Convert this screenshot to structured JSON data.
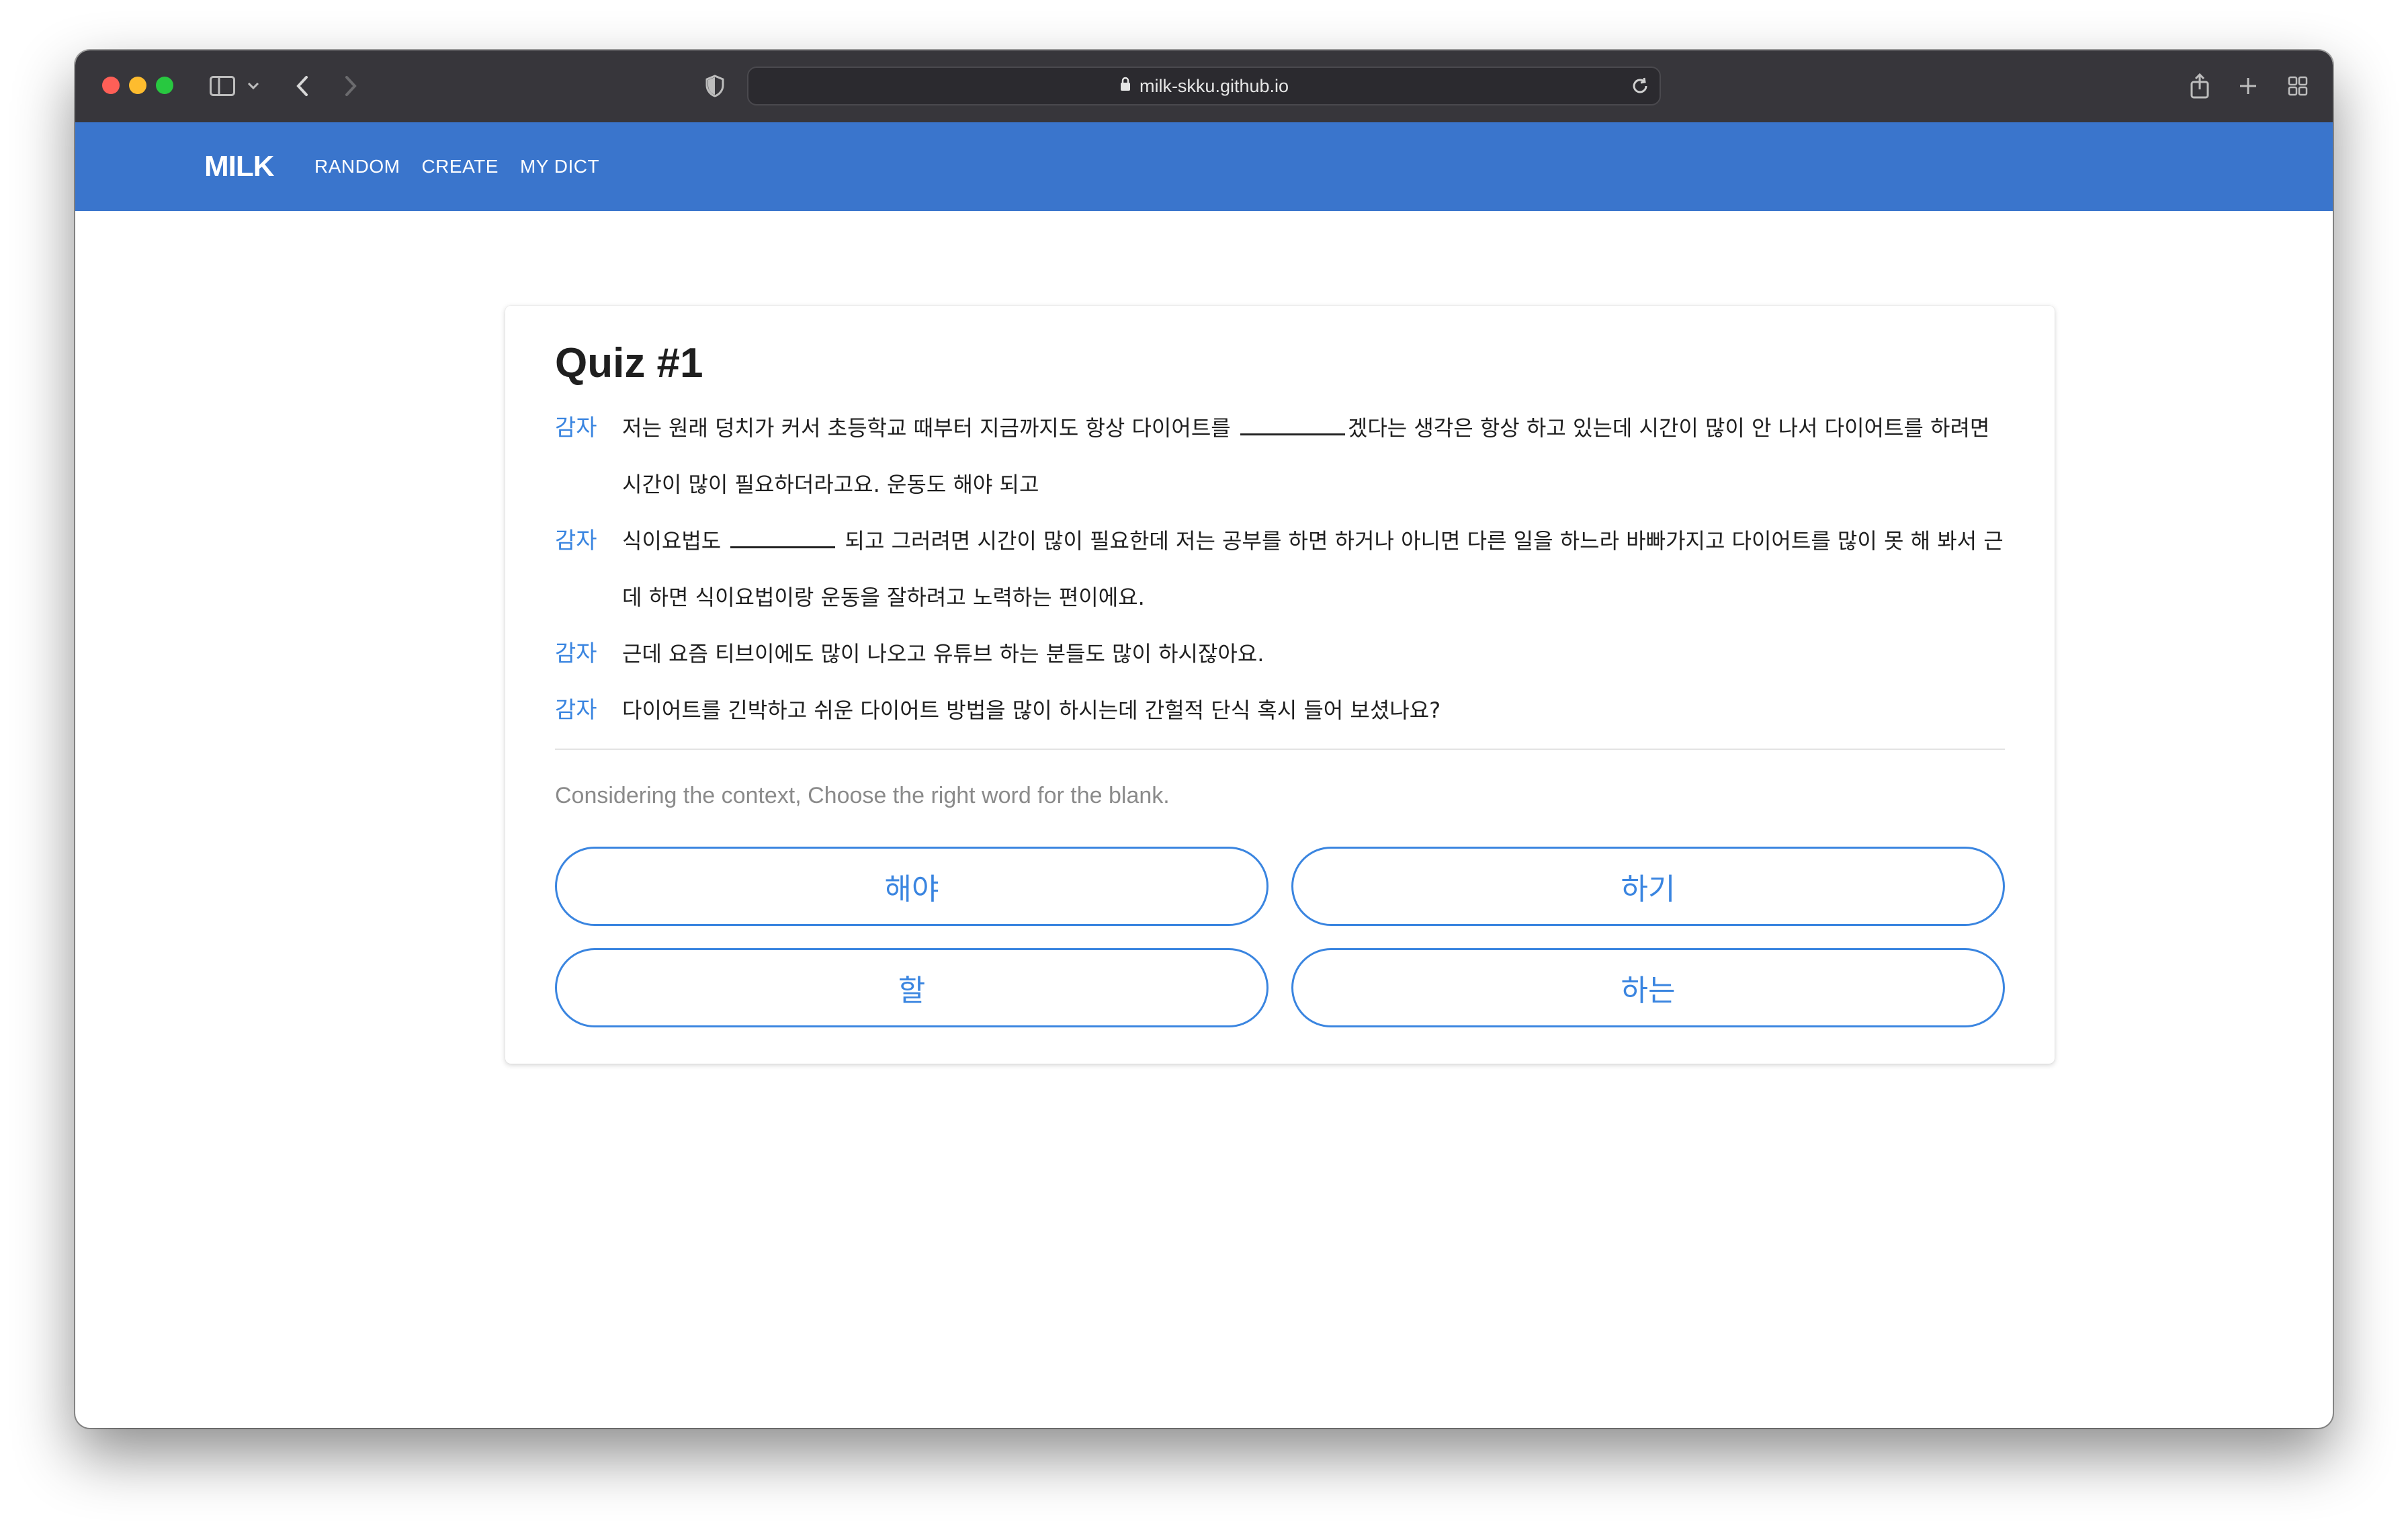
{
  "browser": {
    "url": "milk-skku.github.io"
  },
  "navbar": {
    "brand": "MILK",
    "links": [
      "RANDOM",
      "CREATE",
      "MY DICT"
    ]
  },
  "quiz": {
    "title": "Quiz #1",
    "dialogue": [
      {
        "speaker": "감자",
        "before": "저는 원래 덩치가 커서 초등학교 때부터 지금까지도 항상 다이어트를 ",
        "after": "겠다는 생각은 항상 하고 있는데 시간이 많이 안 나서 다이어트를 하려면 시간이 많이 필요하더라고요. 운동도 해야 되고"
      },
      {
        "speaker": "감자",
        "before": "식이요법도 ",
        "after": " 되고 그러려면 시간이 많이 필요한데 저는 공부를 하면 하거나 아니면 다른 일을 하느라 바빠가지고 다이어트를 많이 못 해 봐서 근데 하면 식이요법이랑 운동을 잘하려고 노력하는 편이에요."
      },
      {
        "speaker": "감자",
        "text": "근데 요즘 티브이에도 많이 나오고 유튜브 하는 분들도 많이 하시잖아요."
      },
      {
        "speaker": "감자",
        "text": "다이어트를 긴박하고 쉬운 다이어트 방법을 많이 하시는데 간헐적 단식 혹시 들어 보셨나요?"
      }
    ],
    "instruction": "Considering the context, Choose the right word for the blank.",
    "answers": [
      "해야",
      "하기",
      "할",
      "하는"
    ]
  },
  "colors": {
    "accent": "#3a75cc",
    "option": "#3a85e0"
  }
}
